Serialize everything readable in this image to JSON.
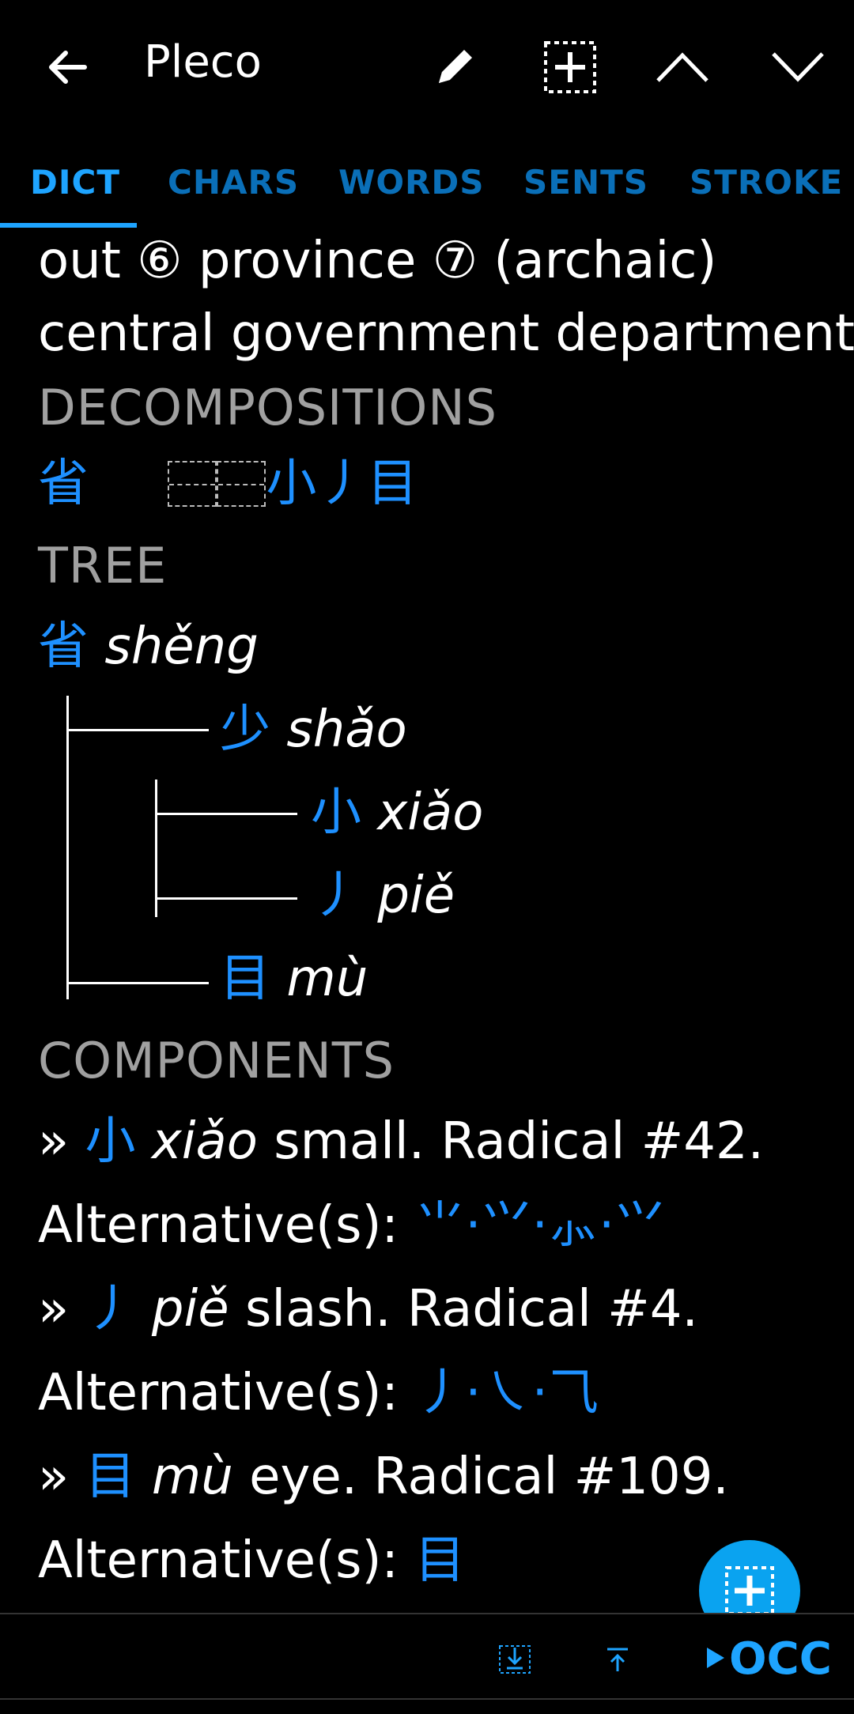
{
  "toolbar": {
    "app_title": "Pleco",
    "icons": [
      "back-arrow-icon",
      "pencil-icon",
      "add-flashcard-icon",
      "chevron-up-icon",
      "chevron-down-icon"
    ]
  },
  "tabs": [
    "DICT",
    "CHARS",
    "WORDS",
    "SENTS",
    "STROKE"
  ],
  "active_tab": "DICT",
  "definition": {
    "line1": "out ⑥ province ⑦ (archaic)",
    "line2": "central government department"
  },
  "decompositions": {
    "header": "DECOMPOSITIONS",
    "char": "省",
    "parts": "小丿目"
  },
  "tree": {
    "header": "TREE",
    "root_char": "省",
    "root_pinyin": "shěng",
    "n1_char": "少",
    "n1_pinyin": "shǎo",
    "n2_char": "小",
    "n2_pinyin": "xiǎo",
    "n3_char": "丿",
    "n3_pinyin": "piě",
    "n4_char": "目",
    "n4_pinyin": "mù"
  },
  "components": {
    "header": "COMPONENTS",
    "items": [
      {
        "prefix": "»",
        "char": "小",
        "pinyin": "xiǎo",
        "gloss": "small. Radical #42.",
        "alt_label": "Alternative(s):",
        "alts": "⺌·⺍·⺗·⺍"
      },
      {
        "prefix": "»",
        "char": "丿",
        "pinyin": "piě",
        "gloss": "slash. Radical #4.",
        "alt_label": "Alternative(s):",
        "alts": "丿·㇏·⺄"
      },
      {
        "prefix": "»",
        "char": "目",
        "pinyin": "mù",
        "gloss": "eye. Radical #109.",
        "alt_label": "Alternative(s):",
        "alts": "目"
      }
    ]
  },
  "bottom_bar": {
    "occ_label": "OCC",
    "icons": [
      "scroll-to-bottom-icon",
      "scroll-to-top-icon",
      "play-triangle-icon"
    ]
  },
  "colors": {
    "accent": "#1ea4ff",
    "link": "#1e90ff",
    "header": "#a0a0a0",
    "background": "#000000"
  }
}
